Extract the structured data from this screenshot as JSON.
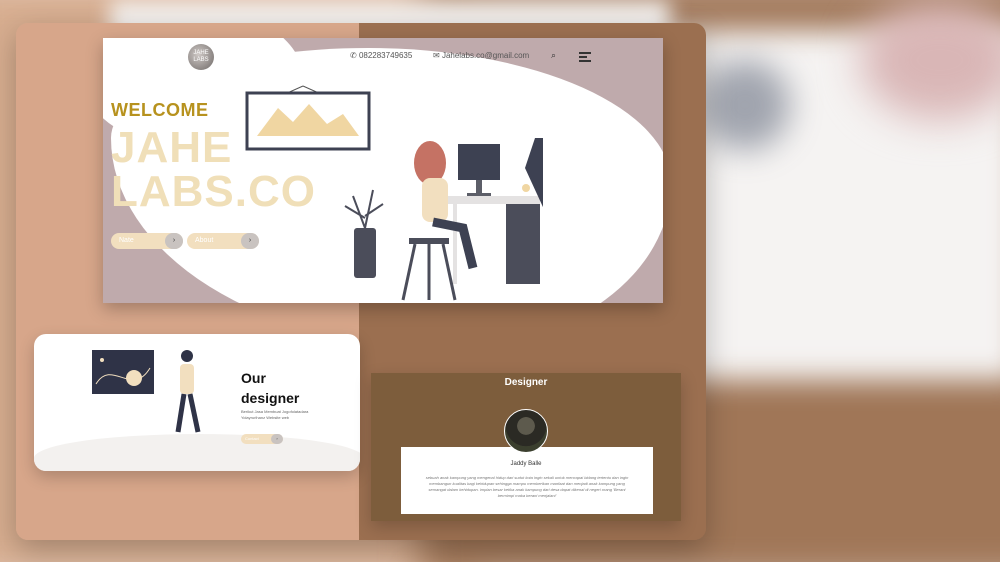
{
  "hero": {
    "logo_text": "JAHE LABS",
    "phone": "082283749635",
    "email": "Jahelabs.co@gmail.com",
    "welcome": "WELCOME",
    "title_line1": "JAHE",
    "title_line2": "LABS.CO",
    "buttons": [
      {
        "label": "Nate",
        "arrow": "›"
      },
      {
        "label": "About",
        "arrow": "›"
      }
    ],
    "icons": {
      "phone": "phone-icon",
      "mail": "mail-icon",
      "search": "search-icon",
      "menu": "menu-icon"
    }
  },
  "designer_card": {
    "title_line1": "Our",
    "title_line2": "designer",
    "description": "Berikut Jasa Membuat Jogofolatadara Yolayrurihanz Website web",
    "button_label": "Contact",
    "arrow": "›"
  },
  "designer_panel": {
    "title": "Designer",
    "name": "Jaddy Balle",
    "bio": "sebuah anak kampung yang mengenal hidup dari sudut kota ingin sekali untuk mencapai bidang tertentu dan ingin membangun kualitas bagi kehidupan sehingga mampu memberikan manfaat dan menjadi anak kampung yang semangat dalam kehidupan. impian besar ketika anak kampung dari desa dapat dikenal di negeri orang 'Berani bermimpi maka berani menjalani'"
  },
  "colors": {
    "accent_gold": "#b7921e",
    "title_cream": "#f0dfb8",
    "brown_panel": "#7d5d3c",
    "hero_mauve": "#bfaaac"
  }
}
